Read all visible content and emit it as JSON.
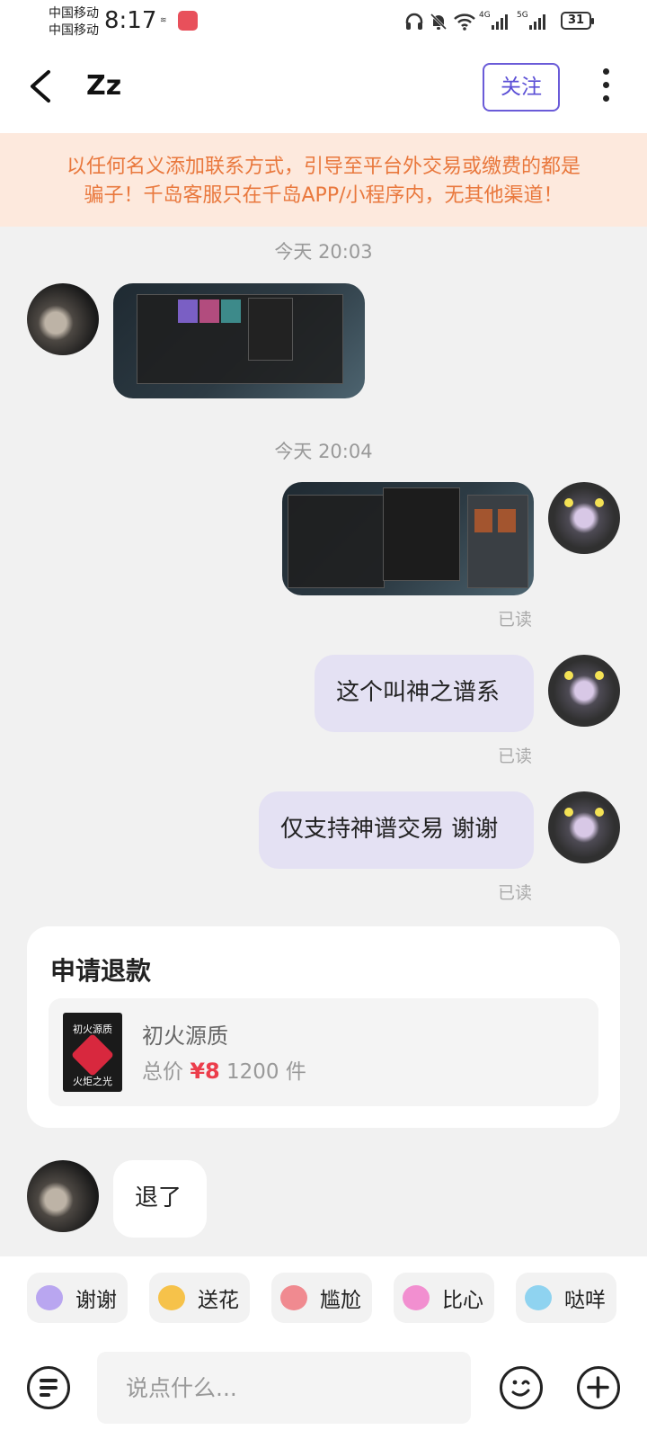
{
  "status_bar": {
    "carrier_1": "中国移动",
    "carrier_2": "中国移动",
    "time": "8:17",
    "battery": "31",
    "net_1": "4G",
    "net_2": "5G"
  },
  "header": {
    "title": "Zz",
    "follow_label": "关注"
  },
  "warning": {
    "line1": "以任何名义添加联系方式，引导至平台外交易或缴费的都是",
    "line2": "骗子！千岛客服只在千岛APP/小程序内，无其他渠道！"
  },
  "chat": {
    "time_1": "今天 20:03",
    "time_2": "今天 20:04",
    "msg_text_1": "这个叫神之谱系",
    "msg_text_2": "仅支持神谱交易 谢谢",
    "read_label": "已读",
    "reply_text": "退了"
  },
  "refund_card": {
    "title": "申请退款",
    "item_name": "初火源质",
    "price_prefix": "总价",
    "price": "¥8",
    "quantity": "1200 件",
    "thumb_top": "初火源质",
    "thumb_bottom": "火炬之光"
  },
  "quick_replies": [
    {
      "label": "谢谢",
      "color": "#b9a6f0"
    },
    {
      "label": "送花",
      "color": "#f6c24a"
    },
    {
      "label": "尴尬",
      "color": "#f08a90"
    },
    {
      "label": "比心",
      "color": "#f28fd0"
    },
    {
      "label": "哒咩",
      "color": "#8fd3f0"
    }
  ],
  "input": {
    "placeholder": "说点什么..."
  },
  "colors": {
    "accent": "#5b4fd6",
    "warning_text": "#e9783d",
    "price": "#ec3d4b"
  }
}
